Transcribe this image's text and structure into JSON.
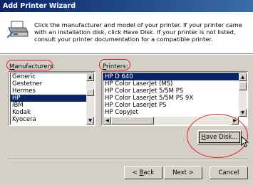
{
  "window": {
    "title": "Add Printer Wizard"
  },
  "header": {
    "instructions": "Click the manufacturer and model of your printer. If your printer came with an installation disk, click Have Disk. If your printer is not listed, consult your printer documentation for a compatible printer."
  },
  "manufacturers": {
    "label_prefix": "",
    "label_underlined": "M",
    "label_rest": "anufacturers:",
    "items": [
      "Generic",
      "Gestetner",
      "Hermes",
      "HP",
      "IBM",
      "Kodak",
      "Kyocera"
    ],
    "selected": "HP"
  },
  "printers": {
    "label_prefix": "",
    "label_underlined": "P",
    "label_rest": "rinters:",
    "items": [
      "HP D 640",
      "HP Color LaserJet (MS)",
      "HP Color LaserJet 5/5M PS",
      "HP Color LaserJet 5/5M PS 9X",
      "HP Color LaserJet PS",
      "HP CopyJet"
    ],
    "selected": "HP D 640"
  },
  "buttons": {
    "have_disk_u": "H",
    "have_disk_rest": "ave Disk...",
    "back_prefix": "< ",
    "back_u": "B",
    "back_rest": "ack",
    "next": "Next >",
    "cancel": "Cancel"
  },
  "icons": {
    "scroll_up": "▲",
    "scroll_down": "▼",
    "scroll_left": "◀",
    "scroll_right": "▶"
  },
  "colors": {
    "title_bar": "#0a246a",
    "selection": "#0a246a",
    "annotation": "#e02020"
  }
}
